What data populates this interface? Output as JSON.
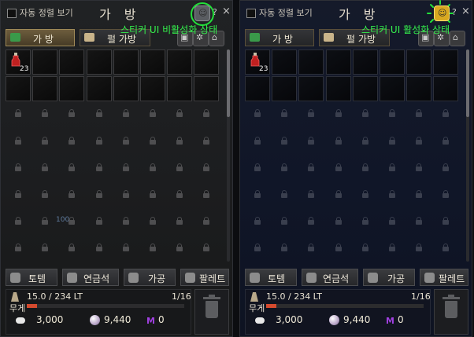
{
  "left_panel": {
    "sort_label": "자동 정렬 보기",
    "title": "가 방",
    "help": "?",
    "close": "×",
    "annotation": "스티커 UI 비활성화 상태",
    "tabs": {
      "bag": "가 방",
      "pet_bag": "펄 가방"
    },
    "item": {
      "quantity": "23"
    },
    "ghost_text": "100",
    "buttons": {
      "totem": "토템",
      "alchemy_stone": "연금석",
      "process": "가공",
      "palette": "팔레트"
    },
    "weight_value": "15.0 / 234 LT",
    "weight_label": "무게",
    "weight_fill": 0.064,
    "slots": "1/16",
    "silver": "3,000",
    "pearls": "9,440",
    "mileage": "0",
    "mileage_symbol": "M"
  },
  "right_panel": {
    "sort_label": "자동 정렬 보기",
    "title": "가 방",
    "help": "?",
    "close": "×",
    "annotation": "스티커 UI 활성화 상태",
    "tabs": {
      "bag": "가 방",
      "pet_bag": "펄 가방"
    },
    "item": {
      "quantity": "23"
    },
    "buttons": {
      "totem": "토템",
      "alchemy_stone": "연금석",
      "process": "가공",
      "palette": "팔레트"
    },
    "weight_value": "15.0 / 234 LT",
    "weight_label": "무게",
    "weight_fill": 0.064,
    "slots": "1/16",
    "silver": "3,000",
    "pearls": "9,440",
    "mileage": "0",
    "mileage_symbol": "M"
  },
  "colors": {
    "annotation_green": "#34f24c",
    "sticker_inactive": "#5a5d62",
    "sticker_active": "#d9a820",
    "weight_bar": "#d44a2e",
    "mileage": "#a040e0"
  },
  "icons": [
    "sticker-icon",
    "help-icon",
    "close-icon",
    "bag-tab-icon",
    "pet-bag-tab-icon",
    "hp-potion-icon",
    "lock-icon",
    "totem-icon",
    "alchemy-stone-icon",
    "process-icon",
    "palette-icon",
    "weight-icon",
    "silver-icon",
    "pearl-icon",
    "mileage-icon",
    "trash-icon"
  ]
}
